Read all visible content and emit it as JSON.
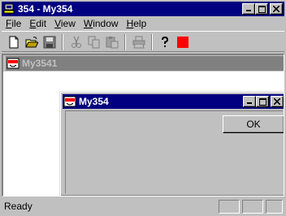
{
  "window": {
    "title": "354 - My354"
  },
  "menubar": {
    "items": [
      {
        "label": "File",
        "accel": "F",
        "rest": "ile"
      },
      {
        "label": "Edit",
        "accel": "E",
        "rest": "dit"
      },
      {
        "label": "View",
        "accel": "V",
        "rest": "iew"
      },
      {
        "label": "Window",
        "accel": "W",
        "rest": "indow"
      },
      {
        "label": "Help",
        "accel": "H",
        "rest": "elp"
      }
    ]
  },
  "toolbar": {
    "buttons": [
      "new-icon",
      "open-icon",
      "save-icon",
      "cut-icon",
      "copy-icon",
      "paste-icon",
      "print-icon",
      "help-icon",
      "stop-icon"
    ],
    "stop_color": "#ff0000"
  },
  "child_windows": {
    "first_title": "My3541",
    "second_title": "My354",
    "ok_label": "OK"
  },
  "colors": {
    "active_title": "#000080",
    "inactive_title": "#808080",
    "face": "#c0c0c0"
  },
  "status": {
    "text": "Ready"
  }
}
